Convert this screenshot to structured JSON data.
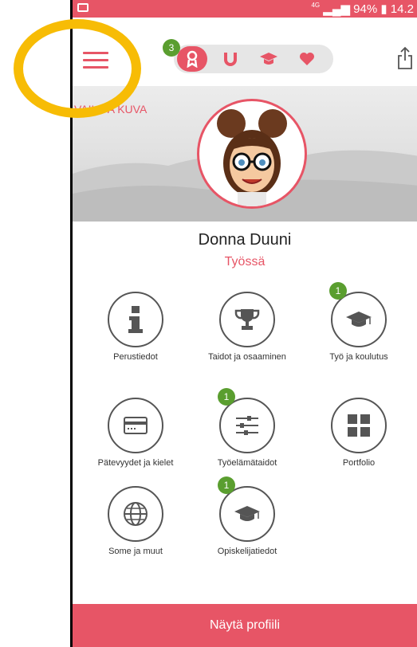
{
  "status_bar": {
    "network": "4G",
    "battery": "94%",
    "time": "14.2"
  },
  "header": {
    "tab_badge": "3",
    "tabs": [
      {
        "name": "badge-icon",
        "active": true
      },
      {
        "name": "magnet-icon",
        "active": false
      },
      {
        "name": "graduation-cap-icon",
        "active": false
      },
      {
        "name": "heart-icon",
        "active": false
      }
    ]
  },
  "cover": {
    "change_label": "VAIHDA KUVA"
  },
  "profile": {
    "name": "Donna Duuni",
    "status": "Työssä"
  },
  "tiles": [
    {
      "label": "Perustiedot",
      "icon": "info-icon",
      "badge": ""
    },
    {
      "label": "Taidot ja osaaminen",
      "icon": "trophy-icon",
      "badge": ""
    },
    {
      "label": "Työ ja koulutus",
      "icon": "graduation-cap-icon",
      "badge": "1"
    },
    {
      "label": "Pätevyydet ja kielet",
      "icon": "card-icon",
      "badge": ""
    },
    {
      "label": "Työelämätaidot",
      "icon": "sliders-icon",
      "badge": "1"
    },
    {
      "label": "Portfolio",
      "icon": "grid-icon",
      "badge": ""
    },
    {
      "label": "Some ja muut",
      "icon": "globe-icon",
      "badge": ""
    },
    {
      "label": "Opiskelijatiedot",
      "icon": "graduation-cap-icon",
      "badge": "1"
    }
  ],
  "footer": {
    "button_label": "Näytä profiili"
  },
  "colors": {
    "accent": "#e75566",
    "badge": "#5a9e2f",
    "highlight": "#f7bc05"
  }
}
